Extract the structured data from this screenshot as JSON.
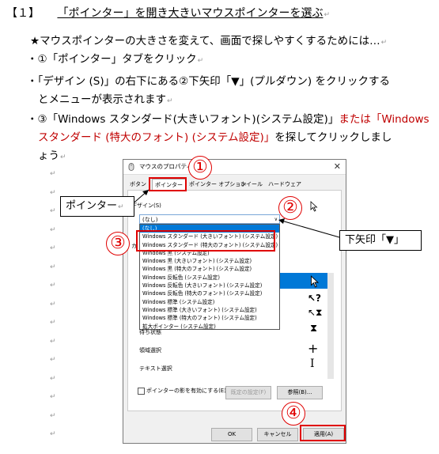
{
  "heading": {
    "prefix": "【１】",
    "title": "「ポインター」を開き大きいマウスポインターを選ぶ"
  },
  "body": {
    "lead": "★マウスポインターの大きさを変えて、画面で探しやすくするためには…",
    "step1": "・①「ポインター」タブをクリック",
    "step2a": "・「デザイン (S)」の右下にある②下矢印「▼」(プルダウン) をクリックする",
    "step2b": "とメニューが表示されます",
    "step3a_black": "・③「Windows スタンダード(大きいフォント)(システム設定)」",
    "step3a_red": "または「Windows",
    "step3b_red": "スタンダード (特大のフォント) (システム設定)」",
    "step3b_black": "を探してクリックしまし",
    "step3c": "ょう"
  },
  "dialog": {
    "title": "マウスのプロパティ",
    "tabs": [
      "ボタン",
      "ポインター",
      "ポインター オプション",
      "ホイール",
      "ハードウェア"
    ],
    "scheme_label": "デザイン(S)",
    "combo_value": "(なし)",
    "list_items": [
      "(なし)",
      "Windows スタンダード (大きいフォント) (システム設定)",
      "Windows スタンダード (特大のフォント) (システム設定)",
      "Windows 黒 (システム設定)",
      "Windows 黒 (大きいフォント) (システム設定)",
      "Windows 黒 (特大のフォント) (システム設定)",
      "Windows 反転色 (システム設定)",
      "Windows 反転色 (大きいフォント) (システム設定)",
      "Windows 反転色 (特大のフォント) (システム設定)",
      "Windows 標準 (システム設定)",
      "Windows 標準 (大きいフォント) (システム設定)",
      "Windows 標準 (特大のフォント) (システム設定)",
      "拡大ポインター (システム設定)"
    ],
    "customize_prefix": "カ",
    "row_wait": "待ち状態",
    "row_area": "領域選択",
    "row_text": "テキスト選択",
    "shadow_checkbox": "ポインターの影を有効にする(E)",
    "default_button": "既定の設定(F)",
    "browse_button": "参照(B)...",
    "ok_button": "OK",
    "cancel_button": "キャンセル",
    "apply_button": "適用(A)"
  },
  "callouts": {
    "pointer": "ポインター",
    "arrow": "下矢印「▼」"
  },
  "markers": [
    "①",
    "②",
    "③",
    "④"
  ],
  "colors": {
    "accent_red": "#e00000",
    "text_red": "#c00000",
    "selection_blue": "#0078d7"
  }
}
